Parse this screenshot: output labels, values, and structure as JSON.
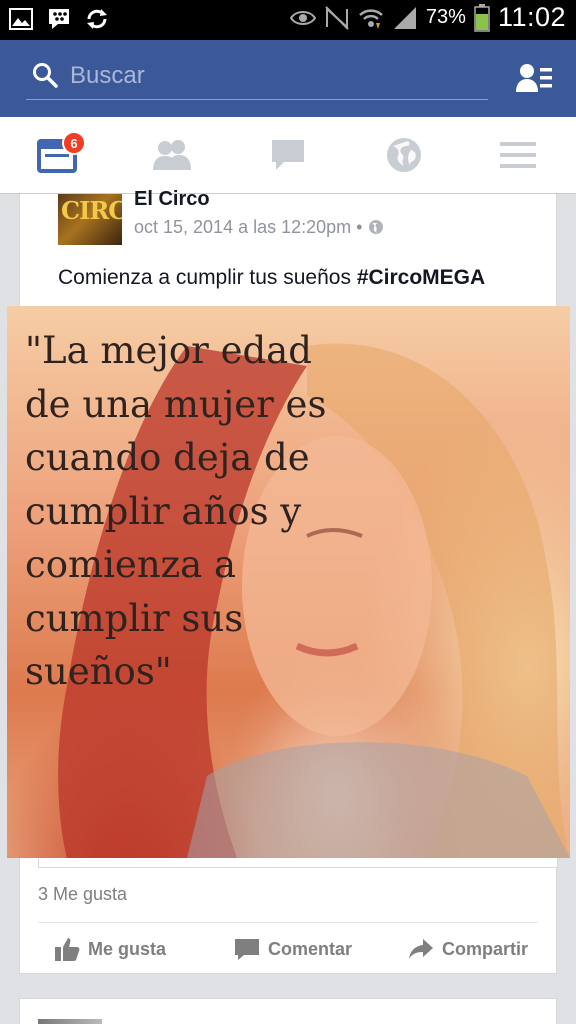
{
  "status_bar": {
    "battery_percent": "73%",
    "time": "11:02"
  },
  "search": {
    "placeholder": "Buscar"
  },
  "tabs": {
    "notifications_badge": "6",
    "items": [
      "news-feed",
      "friend-requests",
      "messages",
      "notifications",
      "more"
    ]
  },
  "post": {
    "author": "El Circo",
    "avatar_text": "CIRCO",
    "timestamp": "oct 15, 2014 a las 12:20pm",
    "separator": "•",
    "text_prefix": "Comienza a cumplir tus sueños ",
    "hashtag": "#CircoMEGA",
    "image_quote_lines": [
      "\"La mejor edad",
      "de una mujer es",
      "cuando deja de",
      "cumplir años y",
      "comienza a",
      "cumplir sus",
      "sueños\""
    ],
    "likes": "3 Me gusta",
    "actions": {
      "like": "Me gusta",
      "comment": "Comentar",
      "share": "Compartir"
    }
  },
  "colors": {
    "facebook_blue": "#3b5998",
    "badge_red": "#f03d25",
    "active_tab": "#4267b2",
    "inactive_icon": "#c8ccd3"
  }
}
